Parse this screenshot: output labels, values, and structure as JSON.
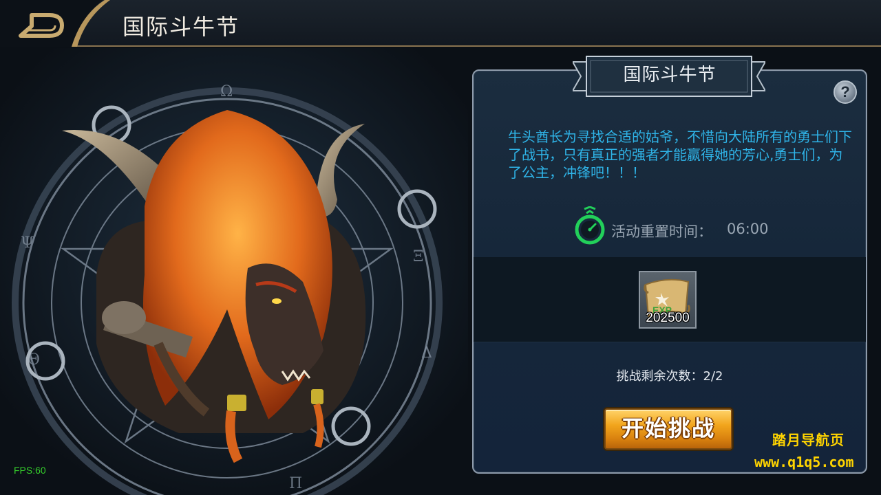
{
  "header": {
    "title": "国际斗牛节",
    "back_icon": "back-arrow-icon"
  },
  "hero": {
    "character": "minotaur-chief",
    "magic_circle_icon": "pentagram-magic-circle"
  },
  "panel": {
    "title": "国际斗牛节",
    "help_label": "?",
    "description": "牛头酋长为寻找合适的姑爷，不惜向大陆所有的勇士们下了战书，只有真正的强者才能赢得她的芳心,勇士们，为了公主，冲锋吧！！！",
    "timer": {
      "label": "活动重置时间：",
      "value": "06:00",
      "icon": "stopwatch-icon"
    },
    "reward": {
      "icon": "exp-scroll-icon",
      "count": "202500"
    },
    "attempts": "挑战剩余次数：2/2",
    "start_button": "开始挑战"
  },
  "debug": {
    "fps": "FPS:60"
  },
  "watermark": {
    "title": "踏月导航页",
    "url": "www.q1q5.com"
  },
  "colors": {
    "accent_gold": "#8a7450",
    "description_blue": "#2fb4e8",
    "timer_green": "#22d05a",
    "button_orange": "#f2a51c",
    "watermark_yellow": "#ffd400",
    "fps_green": "#35d02b"
  }
}
